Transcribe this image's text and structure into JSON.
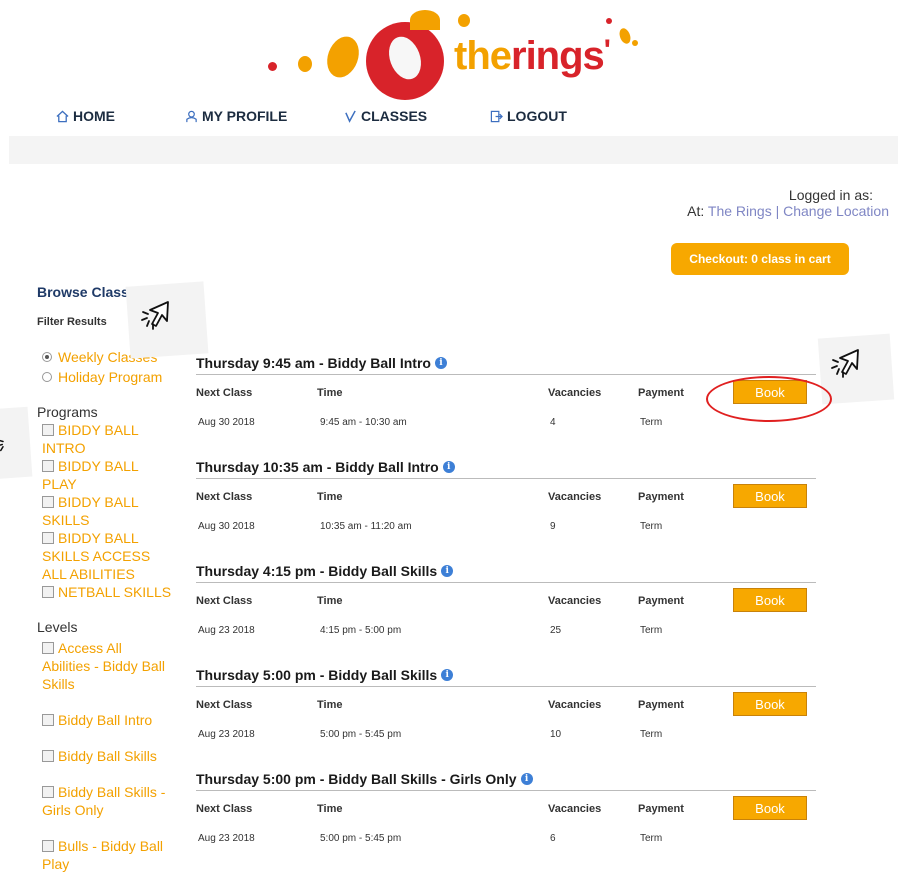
{
  "logo": {
    "word_the": "the",
    "word_rings": "rings"
  },
  "nav": {
    "home": "HOME",
    "profile": "MY PROFILE",
    "classes": "CLASSES",
    "logout": "LOGOUT"
  },
  "login": {
    "logged_in": "Logged in as:",
    "at": "At:",
    "location": "The Rings",
    "separator": "|",
    "change": "Change Location"
  },
  "checkout": "Checkout: 0 class in cart",
  "sidebar": {
    "browse": "Browse Classes",
    "filter": "Filter Results",
    "radios": [
      {
        "label": "Weekly Classes",
        "selected": true
      },
      {
        "label": "Holiday Program",
        "selected": false
      }
    ],
    "programs_heading": "Programs",
    "programs": [
      "BIDDY BALL INTRO",
      "BIDDY BALL PLAY",
      "BIDDY BALL SKILLS",
      "BIDDY BALL SKILLS ACCESS ALL ABILITIES",
      "NETBALL SKILLS"
    ],
    "levels_heading": "Levels",
    "levels": [
      "Access All Abilities - Biddy Ball Skills",
      "Biddy Ball Intro",
      "Biddy Ball Skills",
      "Biddy Ball Skills - Girls Only",
      "Bulls - Biddy Ball Play"
    ]
  },
  "headers": {
    "next": "Next Class",
    "time": "Time",
    "vacancies": "Vacancies",
    "payment": "Payment"
  },
  "book_label": "Book",
  "classes": [
    {
      "title": "Thursday 9:45 am - Biddy Ball Intro",
      "date": "Aug 30 2018",
      "time": "9:45 am - 10:30 am",
      "vacancies": "4",
      "payment": "Term"
    },
    {
      "title": "Thursday 10:35 am - Biddy Ball Intro",
      "date": "Aug 30 2018",
      "time": "10:35 am - 11:20 am",
      "vacancies": "9",
      "payment": "Term"
    },
    {
      "title": "Thursday 4:15 pm - Biddy Ball Skills",
      "date": "Aug 23 2018",
      "time": "4:15 pm - 5:00 pm",
      "vacancies": "25",
      "payment": "Term"
    },
    {
      "title": "Thursday 5:00 pm - Biddy Ball Skills",
      "date": "Aug 23 2018",
      "time": "5:00 pm - 5:45 pm",
      "vacancies": "10",
      "payment": "Term"
    },
    {
      "title": "Thursday 5:00 pm - Biddy Ball Skills - Girls Only",
      "date": "Aug 23 2018",
      "time": "5:00 pm - 5:45 pm",
      "vacancies": "6",
      "payment": "Term"
    }
  ],
  "colors": {
    "accent": "#f7a800",
    "brand_red": "#d8232a",
    "nav_text": "#1c2c40",
    "link": "#7f86c4",
    "heading_blue": "#1f3a67"
  }
}
